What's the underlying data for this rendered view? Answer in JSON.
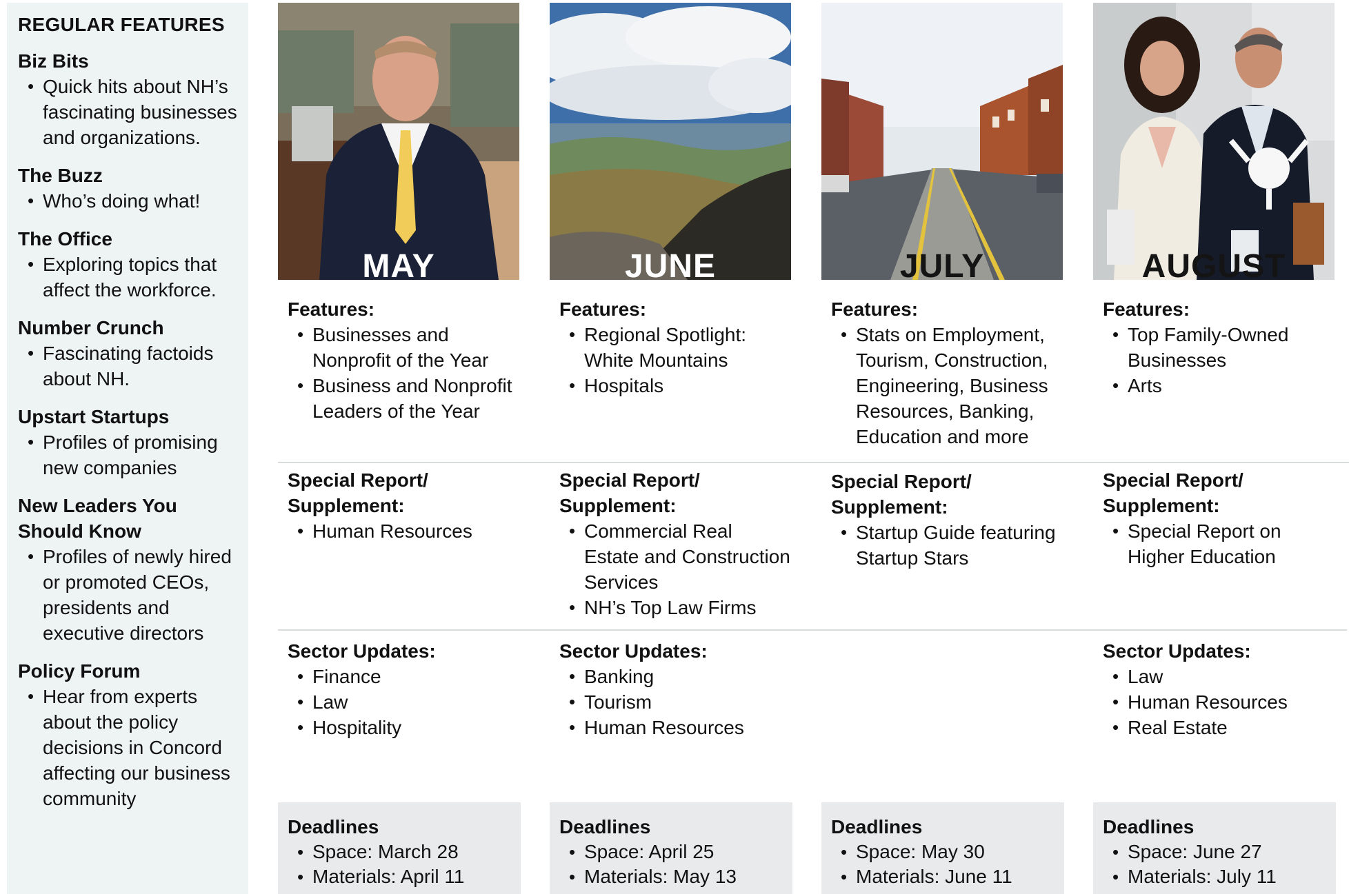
{
  "sidebar": {
    "title": "REGULAR FEATURES",
    "sections": [
      {
        "title": "Biz Bits",
        "items": [
          "Quick hits about NH’s fascinating businesses and organizations."
        ]
      },
      {
        "title": "The Buzz",
        "items": [
          "Who’s doing what!"
        ]
      },
      {
        "title": "The Office",
        "items": [
          "Exploring topics that affect the workforce."
        ]
      },
      {
        "title": "Number Crunch",
        "items": [
          "Fascinating factoids about NH."
        ]
      },
      {
        "title": "Upstart Startups",
        "items": [
          "Profiles of promising new companies"
        ]
      },
      {
        "title": "New Leaders You Should Know",
        "items": [
          "Profiles of newly hired or promoted CEOs, presidents and executive directors"
        ]
      },
      {
        "title": "Policy Forum",
        "items": [
          "Hear from experts about the policy decisions in Concord affecting our business community"
        ]
      }
    ]
  },
  "labels": {
    "features": "Features:",
    "special_line1": "Special Report/",
    "special_line2": "Supplement:",
    "sector": "Sector Updates:",
    "deadlines": "Deadlines"
  },
  "months": [
    {
      "name": "MAY",
      "features": [
        "Businesses and Nonprofit of the Year",
        "Business and Nonprofit Leaders of the Year"
      ],
      "special": [
        "Human Resources"
      ],
      "sectors": [
        "Finance",
        "Law",
        "Hospitality"
      ],
      "deadlines": [
        "Space: March 28",
        "Materials: April 11"
      ]
    },
    {
      "name": "JUNE",
      "features": [
        "Regional Spotlight: White Mountains",
        "Hospitals"
      ],
      "special": [
        "Commercial Real Estate and Construction Services",
        "NH’s Top Law Firms"
      ],
      "sectors": [
        "Banking",
        "Tourism",
        "Human Resources"
      ],
      "deadlines": [
        "Space: April 25",
        "Materials: May 13"
      ]
    },
    {
      "name": "JULY",
      "features": [
        "Stats on Employment, Tourism, Construction, Engineering, Business Resources, Banking, Education and more"
      ],
      "special": [
        "Startup Guide featuring Startup Stars"
      ],
      "sectors": [],
      "deadlines": [
        "Space: May 30",
        "Materials: June 11"
      ]
    },
    {
      "name": "AUGUST",
      "features": [
        "Top Family-Owned Businesses",
        "Arts"
      ],
      "special": [
        "Special Report on Higher Education"
      ],
      "sectors": [
        "Law",
        "Human Resources",
        "Real Estate"
      ],
      "deadlines": [
        "Space: June 27",
        "Materials: July 11"
      ]
    }
  ]
}
